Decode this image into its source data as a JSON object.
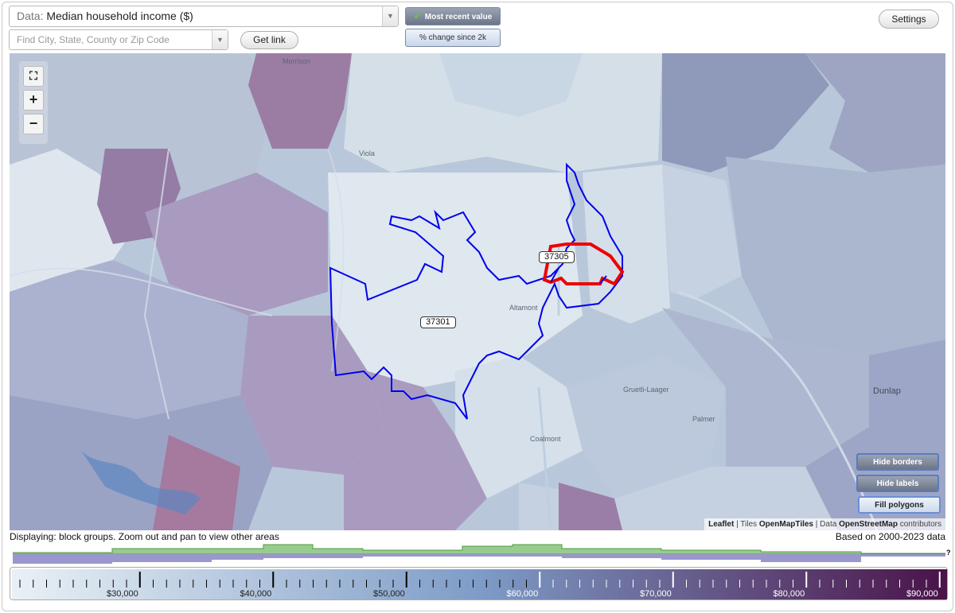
{
  "controls": {
    "data_prefix": "Data:",
    "data_value": "Median household income ($)",
    "search_placeholder": "Find City, State, County or Zip Code",
    "get_link": "Get link",
    "toggle_recent": "Most recent value",
    "toggle_change": "% change since 2k",
    "settings": "Settings"
  },
  "map": {
    "zip_labels": [
      "37305",
      "37301"
    ],
    "places": [
      "Morrison",
      "Viola",
      "Altamont",
      "Gruetli-Laager",
      "Palmer",
      "Coalmont",
      "Dunlap"
    ],
    "buttons": {
      "hide_borders": "Hide borders",
      "hide_labels": "Hide labels",
      "fill_polygons": "Fill polygons"
    },
    "attribution": {
      "leaflet": "Leaflet",
      "tiles_prefix": "| Tiles",
      "tiles": "OpenMapTiles",
      "data_prefix": "| Data",
      "data": "OpenStreetMap",
      "suffix": "contributors"
    },
    "zoom": {
      "in": "+",
      "out": "−"
    }
  },
  "status": {
    "left": "Displaying: block groups. Zoom out and pan to view other areas",
    "right": "Based on 2000-2023 data",
    "help": "?"
  },
  "legend": {
    "ticks": [
      "$30,000",
      "$40,000",
      "$50,000",
      "$60,000",
      "$70,000",
      "$80,000",
      "$90,000"
    ],
    "colors": {
      "low": "#e9f1f6",
      "mid": "#7e9cc7",
      "high": "#4a1248"
    }
  }
}
